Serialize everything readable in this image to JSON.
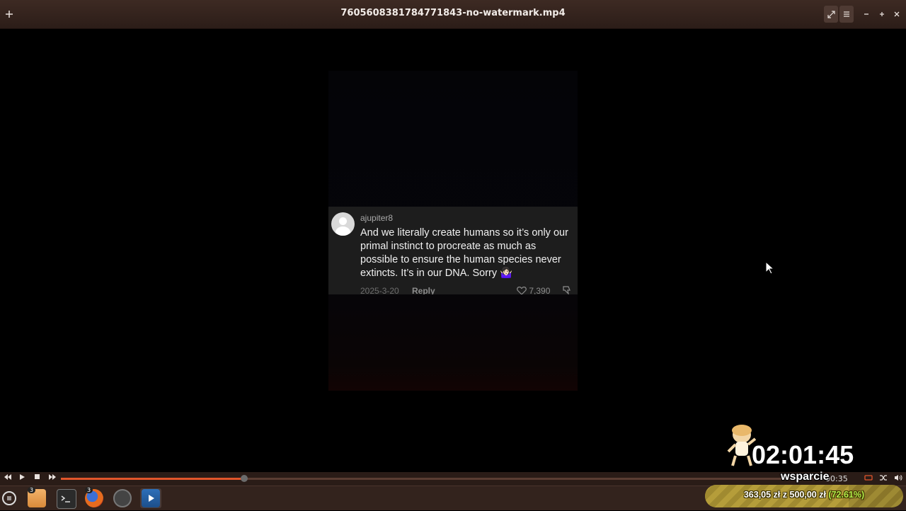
{
  "window": {
    "title": "7605608381784771843-no-watermark.mp4"
  },
  "titlebar": {
    "new_tab_icon": "plus-icon",
    "buttons": [
      "fullscreen-icon",
      "menu-icon",
      "minimize-icon",
      "maximize-icon",
      "close-icon"
    ]
  },
  "comment": {
    "username": "ajupiter8",
    "text": "And we literally create humans so it’s only our primal instinct to procreate as much as possible to ensure the human species never extincts. It’s in our DNA. Sorry 🤷🏻‍♀️",
    "date": "2025-3-20",
    "reply_label": "Reply",
    "likes": "7,390"
  },
  "player": {
    "progress": 0.24,
    "time_text": "00:35"
  },
  "overlay": {
    "timer": "02:01:45",
    "support_label": "wsparcie",
    "donation": {
      "amount": "363,05 zł",
      "separator": "z",
      "goal": "500,00 zł",
      "percent_text": "(72.61%)",
      "fraction": 0.7261
    }
  },
  "taskbar": {
    "launchers": [
      {
        "name": "files",
        "badge": "3"
      },
      {
        "name": "terminal",
        "badge": ""
      },
      {
        "name": "firefox",
        "badge": "3"
      },
      {
        "name": "system-monitor",
        "badge": ""
      },
      {
        "name": "video-player",
        "badge": ""
      }
    ]
  },
  "colors": {
    "titlebar": "#3d2a23",
    "seek_fill": "#e2552b",
    "panel": "#33231d"
  }
}
